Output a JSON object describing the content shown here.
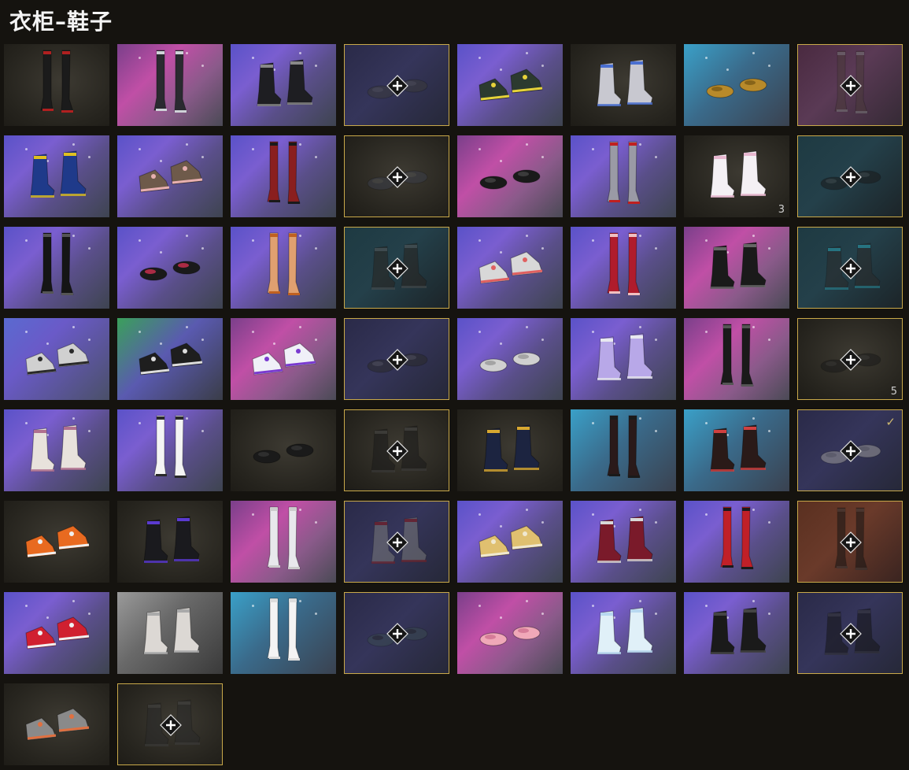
{
  "page_title": "衣柜–鞋子",
  "colors": {
    "background": "#15130f",
    "locked_border": "#c9a94a",
    "check": "#cdb870"
  },
  "tiles": [
    {
      "bg": "dark",
      "shoe": "thigh_boot",
      "c": "#1b1b1b",
      "a": "#b02020",
      "state": "owned"
    },
    {
      "bg": "pink",
      "shoe": "thigh_boot",
      "c": "#2a2a30",
      "a": "#cfd2d8",
      "state": "owned"
    },
    {
      "bg": "purple",
      "shoe": "boot",
      "c": "#1e1e22",
      "a": "#888",
      "state": "owned"
    },
    {
      "bg": "navy",
      "shoe": "shoe",
      "c": "#3a3a3a",
      "a": "#555",
      "state": "locked"
    },
    {
      "bg": "purple",
      "shoe": "sneaker",
      "c": "#2c3a2f",
      "a": "#e6d23a",
      "state": "owned"
    },
    {
      "bg": "dark",
      "shoe": "boot",
      "c": "#c8c8d0",
      "a": "#4a6fd0",
      "state": "owned"
    },
    {
      "bg": "teal",
      "shoe": "shoe",
      "c": "#b88a2a",
      "a": "#7a5a15",
      "state": "owned"
    },
    {
      "bg": "mauve",
      "shoe": "thigh_boot",
      "c": "#4a3a3a",
      "a": "#777",
      "state": "locked"
    },
    {
      "bg": "purple",
      "shoe": "boot",
      "c": "#1f3a8a",
      "a": "#e0c020",
      "state": "owned"
    },
    {
      "bg": "purple",
      "shoe": "sneaker",
      "c": "#6e5a4a",
      "a": "#e8b0b0",
      "state": "owned"
    },
    {
      "bg": "purple",
      "shoe": "thigh_boot",
      "c": "#8a1f1f",
      "a": "#1a1a1a",
      "state": "owned"
    },
    {
      "bg": "dark",
      "shoe": "shoe",
      "c": "#3a3d48",
      "a": "#555",
      "state": "locked"
    },
    {
      "bg": "pink",
      "shoe": "shoe",
      "c": "#1a1a1a",
      "a": "#444",
      "state": "owned"
    },
    {
      "bg": "purple",
      "shoe": "thigh_boot",
      "c": "#9a9aa5",
      "a": "#c02020",
      "state": "owned"
    },
    {
      "bg": "dark",
      "shoe": "boot",
      "c": "#f4f0f4",
      "a": "#e8b8d0",
      "state": "owned",
      "count": "3"
    },
    {
      "bg": "darkteal",
      "shoe": "shoe",
      "c": "#1a1a1a",
      "a": "#444",
      "state": "locked"
    },
    {
      "bg": "purple",
      "shoe": "thigh_boot",
      "c": "#151515",
      "a": "#555",
      "state": "owned"
    },
    {
      "bg": "purple",
      "shoe": "shoe",
      "c": "#1a1a1a",
      "a": "#d03050",
      "state": "owned"
    },
    {
      "bg": "purple",
      "shoe": "thigh_boot",
      "c": "#e0a070",
      "a": "#c06020",
      "state": "owned"
    },
    {
      "bg": "darkteal",
      "shoe": "boot",
      "c": "#2a2420",
      "a": "#555",
      "state": "locked"
    },
    {
      "bg": "purple",
      "shoe": "sneaker",
      "c": "#d8d8d8",
      "a": "#e06060",
      "state": "owned"
    },
    {
      "bg": "purple",
      "shoe": "thigh_boot",
      "c": "#b01c2c",
      "a": "#f0c0c0",
      "state": "owned"
    },
    {
      "bg": "pink",
      "shoe": "boot",
      "c": "#1a1a1a",
      "a": "#666",
      "state": "owned"
    },
    {
      "bg": "darkteal",
      "shoe": "boot",
      "c": "#2a2a2a",
      "a": "#2aa0b0",
      "state": "locked"
    },
    {
      "bg": "blue",
      "shoe": "sneaker",
      "c": "#d0d0d0",
      "a": "#2a2a2a",
      "state": "owned"
    },
    {
      "bg": "green",
      "shoe": "sneaker",
      "c": "#1e1e1e",
      "a": "#ddd",
      "state": "owned"
    },
    {
      "bg": "pink",
      "shoe": "sneaker",
      "c": "#f0f0f8",
      "a": "#7a3ad0",
      "state": "owned"
    },
    {
      "bg": "navy",
      "shoe": "shoe",
      "c": "#2a2a2a",
      "a": "#555",
      "state": "locked"
    },
    {
      "bg": "purple",
      "shoe": "shoe",
      "c": "#d0d0d0",
      "a": "#999",
      "state": "owned"
    },
    {
      "bg": "purple",
      "shoe": "boot",
      "c": "#b8a8e8",
      "a": "#e8e8f0",
      "state": "owned"
    },
    {
      "bg": "pink",
      "shoe": "thigh_boot",
      "c": "#1a1a1a",
      "a": "#555",
      "state": "owned"
    },
    {
      "bg": "dark",
      "shoe": "shoe",
      "c": "#1a1a1a",
      "a": "#333",
      "state": "locked",
      "count": "5"
    },
    {
      "bg": "purple",
      "shoe": "boot",
      "c": "#e8e2dc",
      "a": "#b07090",
      "state": "owned"
    },
    {
      "bg": "purple",
      "shoe": "thigh_boot",
      "c": "#f4f4f4",
      "a": "#2a2a2a",
      "state": "owned"
    },
    {
      "bg": "dark",
      "shoe": "shoe",
      "c": "#1a1a1a",
      "a": "#333",
      "state": "owned"
    },
    {
      "bg": "dark",
      "shoe": "boot",
      "c": "#1a1a1a",
      "a": "#444",
      "state": "locked"
    },
    {
      "bg": "dark",
      "shoe": "boot",
      "c": "#1c2440",
      "a": "#d8a830",
      "state": "owned"
    },
    {
      "bg": "teal",
      "shoe": "thigh_boot",
      "c": "#2a1a1a",
      "a": "#1a1a1a",
      "state": "owned"
    },
    {
      "bg": "teal",
      "shoe": "boot",
      "c": "#2a1a18",
      "a": "#d04040",
      "state": "owned"
    },
    {
      "bg": "navy",
      "shoe": "shoe",
      "c": "#9a9898",
      "a": "#777",
      "state": "locked",
      "checked": true
    },
    {
      "bg": "dark",
      "shoe": "sneaker",
      "c": "#e86a20",
      "a": "#f0f0f0",
      "state": "owned"
    },
    {
      "bg": "dark",
      "shoe": "boot",
      "c": "#1a1a1e",
      "a": "#5a3ad0",
      "state": "owned"
    },
    {
      "bg": "pink",
      "shoe": "thigh_boot",
      "c": "#e8e8ec",
      "a": "#ccc",
      "state": "owned"
    },
    {
      "bg": "navy",
      "shoe": "boot",
      "c": "#7a7a7a",
      "a": "#8a1a1a",
      "state": "locked"
    },
    {
      "bg": "purple",
      "shoe": "sneaker",
      "c": "#e0c070",
      "a": "#f0e8d0",
      "state": "owned"
    },
    {
      "bg": "purple",
      "shoe": "boot",
      "c": "#7a1a2a",
      "a": "#d8d8d8",
      "state": "owned"
    },
    {
      "bg": "purple",
      "shoe": "thigh_boot",
      "c": "#c02028",
      "a": "#1a1a1a",
      "state": "owned"
    },
    {
      "bg": "brown",
      "shoe": "thigh_boot",
      "c": "#151515",
      "a": "#333",
      "state": "locked"
    },
    {
      "bg": "purple",
      "shoe": "sneaker",
      "c": "#d02030",
      "a": "#f0f0f0",
      "state": "owned"
    },
    {
      "bg": "grey",
      "shoe": "boot",
      "c": "#dcd8d4",
      "a": "#aaa",
      "state": "owned"
    },
    {
      "bg": "teal",
      "shoe": "thigh_boot",
      "c": "#f4f4f4",
      "a": "#ddd",
      "state": "owned"
    },
    {
      "bg": "navy",
      "shoe": "shoe",
      "c": "#3a4a50",
      "a": "#222",
      "state": "locked"
    },
    {
      "bg": "pink",
      "shoe": "shoe",
      "c": "#f0a8b8",
      "a": "#d07090",
      "state": "owned"
    },
    {
      "bg": "purple",
      "shoe": "boot",
      "c": "#e0f0f8",
      "a": "#b8d8f0",
      "state": "owned"
    },
    {
      "bg": "purple",
      "shoe": "boot",
      "c": "#1a1a1a",
      "a": "#444",
      "state": "owned"
    },
    {
      "bg": "navy",
      "shoe": "boot",
      "c": "#151515",
      "a": "#333",
      "state": "locked"
    },
    {
      "bg": "dark",
      "shoe": "sneaker",
      "c": "#8a8a8a",
      "a": "#e07040",
      "state": "owned"
    },
    {
      "bg": "dark",
      "shoe": "boot",
      "c": "#2a2a2a",
      "a": "#444",
      "state": "locked"
    }
  ]
}
